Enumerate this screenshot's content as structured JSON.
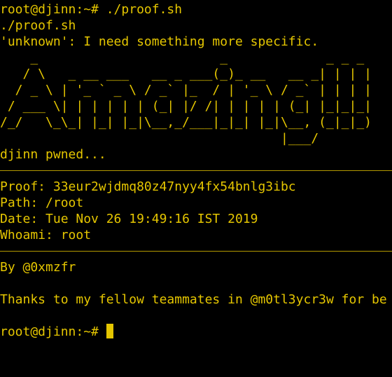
{
  "terminal": {
    "cmd_line": "root@djinn:~# ./proof.sh",
    "echo_line": "./proof.sh",
    "error_line": "'unknown': I need something more specific.",
    "banner_ascii": "    _                        _             _ _ _ \n   / \\   _ __ ___   __ _ ___(_)_ __   __ _| | | |\n  / _ \\ | '_ ` _ \\ / _` |_  / | '_ \\ / _` | | | |\n / ___ \\| | | | | | (_| |/ /| | | | | (_| |_|_|_|\n/_/   \\_\\_| |_| |_|\\__,_/___|_|_| |_|\\__, (_|_|_)\n                                     |___/",
    "pwned_line": "djinn pwned...",
    "proof_line": "Proof: 33eur2wjdmq80z47nyy4fx54bnlg3ibc",
    "path_line": "Path: /root",
    "date_line": "Date: Tue Nov 26 19:49:16 IST 2019",
    "whoami_line": "Whoami: root",
    "by_line": "By @0xmzfr",
    "thanks_line": "Thanks to my fellow teammates in @m0tl3ycr3w for be",
    "prompt_line": "root@djinn:~# ",
    "text_color": "#e5c600",
    "background_color": "#000000"
  }
}
